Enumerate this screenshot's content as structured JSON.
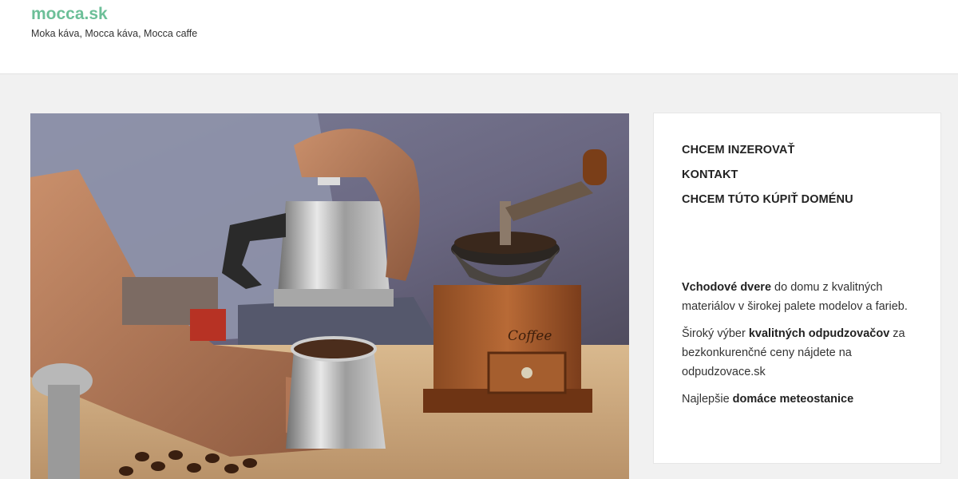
{
  "header": {
    "site_title": "mocca.sk",
    "tagline": "Moka káva, Mocca káva, Mocca caffe"
  },
  "hero": {
    "grinder_label": "Coffee"
  },
  "sidebar": {
    "menu": [
      {
        "label": "CHCEM INZEROVAŤ"
      },
      {
        "label": "KONTAKT"
      },
      {
        "label": "CHCEM TÚTO KÚPIŤ DOMÉNU"
      }
    ],
    "paragraphs": [
      {
        "link": "Vchodové dvere",
        "rest": " do domu z kvalitných materiálov v širokej palete modelov a farieb."
      },
      {
        "pre": "Široký výber ",
        "link": "kvalitných odpudzovačov",
        "rest": " za bezkonkurenčné ceny nájdete na odpudzovace.sk"
      },
      {
        "pre": "Najlepšie ",
        "link": "domáce meteostanice"
      }
    ]
  },
  "colors": {
    "accent": "#6cbf98",
    "background": "#f1f1f1",
    "text": "#333333"
  }
}
